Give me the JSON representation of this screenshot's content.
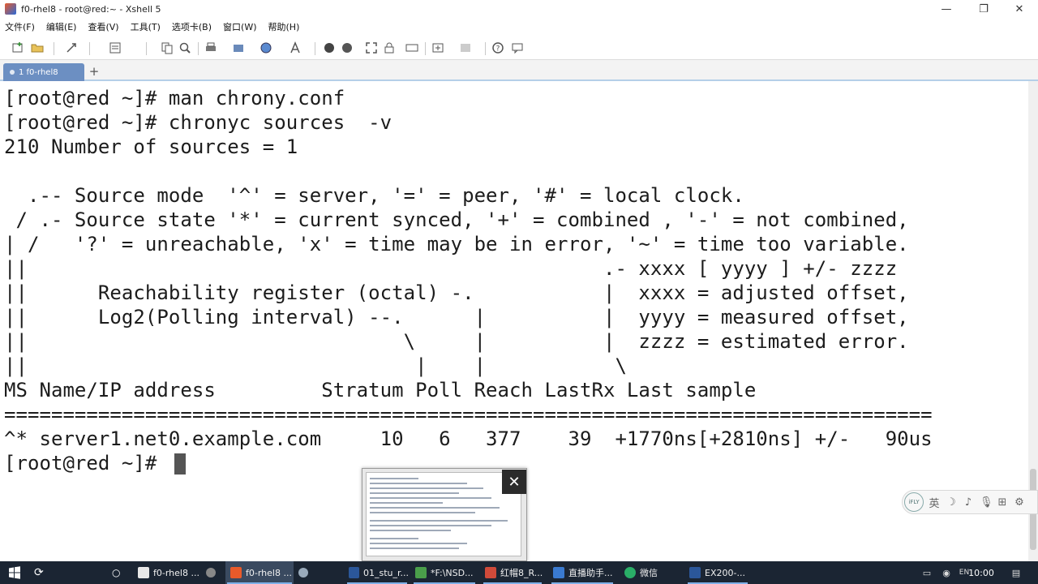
{
  "window": {
    "title": "f0-rhel8 - root@red:~ - Xshell 5",
    "minimize": "—",
    "restore": "❐",
    "close": "✕"
  },
  "menu": [
    "文件(F)",
    "编辑(E)",
    "查看(V)",
    "工具(T)",
    "选项卡(B)",
    "窗口(W)",
    "帮助(H)"
  ],
  "tabs": {
    "active_label": "1 f0-rhel8",
    "add_label": "+"
  },
  "terminal": {
    "lines": [
      "[root@red ~]# man chrony.conf",
      "[root@red ~]# chronyc sources  -v",
      "210 Number of sources = 1",
      "",
      "  .-- Source mode  '^' = server, '=' = peer, '#' = local clock.",
      " / .- Source state '*' = current synced, '+' = combined , '-' = not combined,",
      "| /   '?' = unreachable, 'x' = time may be in error, '~' = time too variable.",
      "||                                                 .- xxxx [ yyyy ] +/- zzzz",
      "||      Reachability register (octal) -.           |  xxxx = adjusted offset,",
      "||      Log2(Polling interval) --.      |          |  yyyy = measured offset,",
      "||                                \\     |          |  zzzz = estimated error.",
      "||                                 |    |           \\",
      "MS Name/IP address         Stratum Poll Reach LastRx Last sample",
      "===============================================================================",
      "^* server1.net0.example.com     10   6   377    39  +1770ns[+2810ns] +/-   90us",
      "[root@red ~]# "
    ]
  },
  "preview": {
    "close": "✕"
  },
  "ifly": {
    "logo": "iFLY",
    "buttons": [
      "英",
      "☽",
      "♪",
      "🎙",
      "⊞",
      "⚙"
    ]
  },
  "taskbar": {
    "items": [
      {
        "label": "f0-rhel8 ...",
        "color": "#e8e8e8"
      },
      {
        "label": "f0-rhel8 ...",
        "color": "#e85a2a"
      },
      {
        "label": "01_stu_r...",
        "color": "#2b579a"
      },
      {
        "label": "*F:\\NSD...",
        "color": "#4a9e4a"
      },
      {
        "label": "红帽8_R...",
        "color": "#d04a3a"
      },
      {
        "label": "直播助手...",
        "color": "#3a7ad0"
      },
      {
        "label": "微信",
        "color": "#2aae67"
      },
      {
        "label": "EX200-...",
        "color": "#2b579a"
      }
    ],
    "clock": "10:00"
  }
}
